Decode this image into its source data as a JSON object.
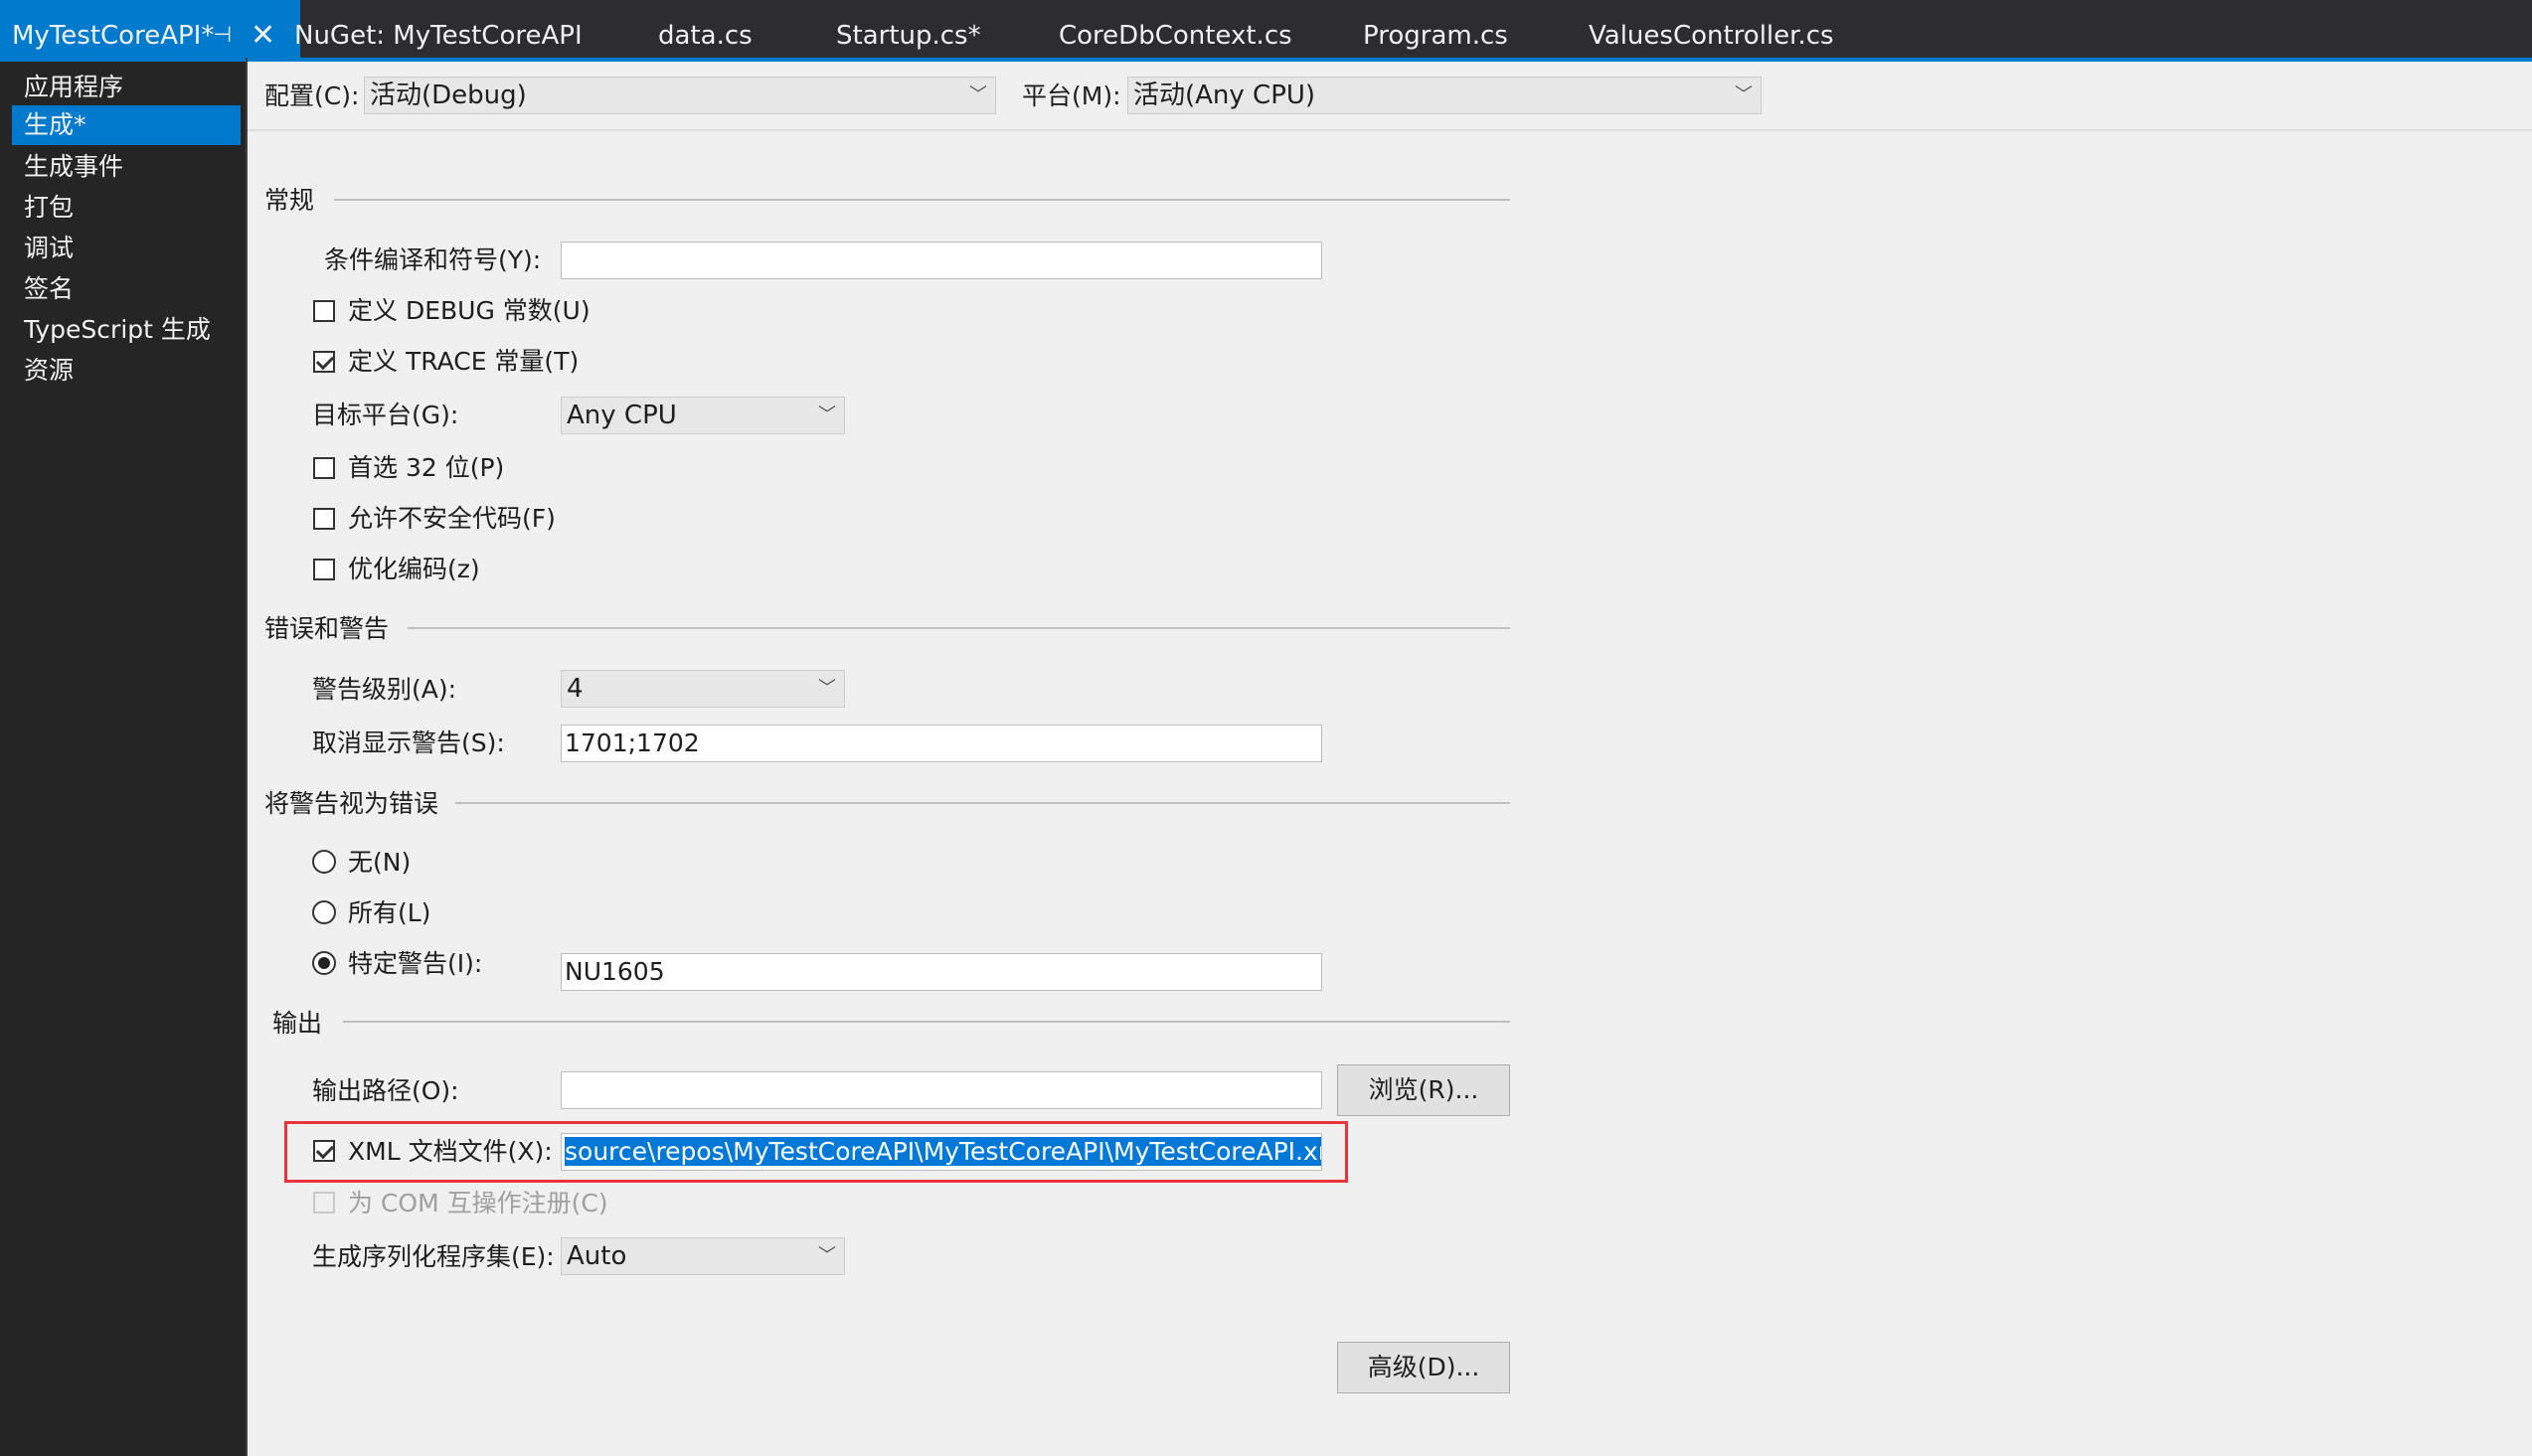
{
  "tabs": [
    {
      "label": "MyTestCoreAPI*",
      "active": true
    },
    {
      "label": "NuGet: MyTestCoreAPI"
    },
    {
      "label": "data.cs"
    },
    {
      "label": "Startup.cs*"
    },
    {
      "label": "CoreDbContext.cs"
    },
    {
      "label": "Program.cs"
    },
    {
      "label": "ValuesController.cs"
    }
  ],
  "tab_pin_icon": "⊣",
  "tab_close_icon": "✕",
  "sidebar": {
    "items": [
      {
        "label": "应用程序"
      },
      {
        "label": "生成*",
        "selected": true
      },
      {
        "label": "生成事件"
      },
      {
        "label": "打包"
      },
      {
        "label": "调试"
      },
      {
        "label": "签名"
      },
      {
        "label": "TypeScript 生成"
      },
      {
        "label": "资源"
      }
    ]
  },
  "top": {
    "config_label": "配置(C):",
    "config_value": "活动(Debug)",
    "platform_label": "平台(M):",
    "platform_value": "活动(Any CPU)"
  },
  "general": {
    "title": "常规",
    "conditional_symbols_label": "条件编译和符号(Y):",
    "conditional_symbols_value": "",
    "define_debug_label": "定义 DEBUG 常数(U)",
    "define_debug_checked": false,
    "define_trace_label": "定义 TRACE 常量(T)",
    "define_trace_checked": true,
    "target_platform_label": "目标平台(G):",
    "target_platform_value": "Any CPU",
    "prefer32_label": "首选 32 位(P)",
    "prefer32_checked": false,
    "unsafe_label": "允许不安全代码(F)",
    "unsafe_checked": false,
    "optimize_label": "优化编码(z)",
    "optimize_checked": false
  },
  "errors": {
    "title": "错误和警告",
    "warning_level_label": "警告级别(A):",
    "warning_level_value": "4",
    "suppress_label": "取消显示警告(S):",
    "suppress_value": "1701;1702"
  },
  "treat_warnings": {
    "title": "将警告视为错误",
    "none_label": "无(N)",
    "all_label": "所有(L)",
    "specific_label": "特定警告(I):",
    "specific_value": "NU1605",
    "selected": "specific"
  },
  "output": {
    "title": "输出",
    "path_label": "输出路径(O):",
    "path_value": "",
    "browse_label": "浏览(R)...",
    "xml_doc_label": "XML 文档文件(X):",
    "xml_doc_checked": true,
    "xml_doc_value": "source\\repos\\MyTestCoreAPI\\MyTestCoreAPI\\MyTestCoreAPI.xml",
    "com_label": "为 COM 互操作注册(C)",
    "com_checked": false,
    "serialization_label": "生成序列化程序集(E):",
    "serialization_value": "Auto"
  },
  "advanced_label": "高级(D)...",
  "colors": {
    "accent": "#007acc",
    "highlight_box": "#e8343a",
    "selection": "#0078d7"
  }
}
